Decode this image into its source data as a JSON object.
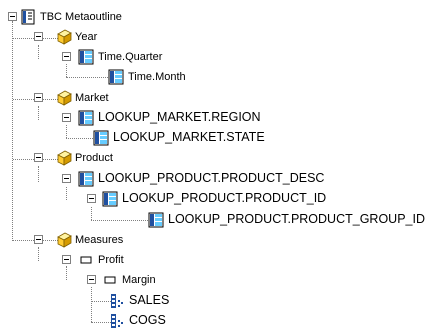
{
  "tree": {
    "root": {
      "label": "TBC Metaoutline",
      "icon": "outline-icon"
    },
    "year": {
      "label": "Year",
      "icon": "dimension-icon",
      "quarter": {
        "label": "Time.Quarter",
        "icon": "level-icon"
      },
      "month": {
        "label": "Time.Month",
        "icon": "level-icon"
      }
    },
    "market": {
      "label": "Market",
      "icon": "dimension-icon",
      "region": {
        "label": "LOOKUP_MARKET.REGION",
        "icon": "level-icon"
      },
      "state": {
        "label": "LOOKUP_MARKET.STATE",
        "icon": "level-icon"
      }
    },
    "product": {
      "label": "Product",
      "icon": "dimension-icon",
      "desc": {
        "label": "LOOKUP_PRODUCT.PRODUCT_DESC",
        "icon": "level-icon"
      },
      "id": {
        "label": "LOOKUP_PRODUCT.PRODUCT_ID",
        "icon": "level-icon"
      },
      "group": {
        "label": "LOOKUP_PRODUCT.PRODUCT_GROUP_ID",
        "icon": "level-icon"
      }
    },
    "measures": {
      "label": "Measures",
      "icon": "dimension-icon",
      "profit": {
        "label": "Profit",
        "icon": "member-box-icon"
      },
      "margin": {
        "label": "Margin",
        "icon": "member-box-icon"
      },
      "sales": {
        "label": "SALES",
        "icon": "measure-icon"
      },
      "cogs": {
        "label": "COGS",
        "icon": "measure-icon"
      }
    }
  },
  "colors": {
    "dimension_yellow": "#ffcc33",
    "level_blue": "#2050a0",
    "level_cyan": "#66ccff",
    "tree_lines": "#808080"
  }
}
